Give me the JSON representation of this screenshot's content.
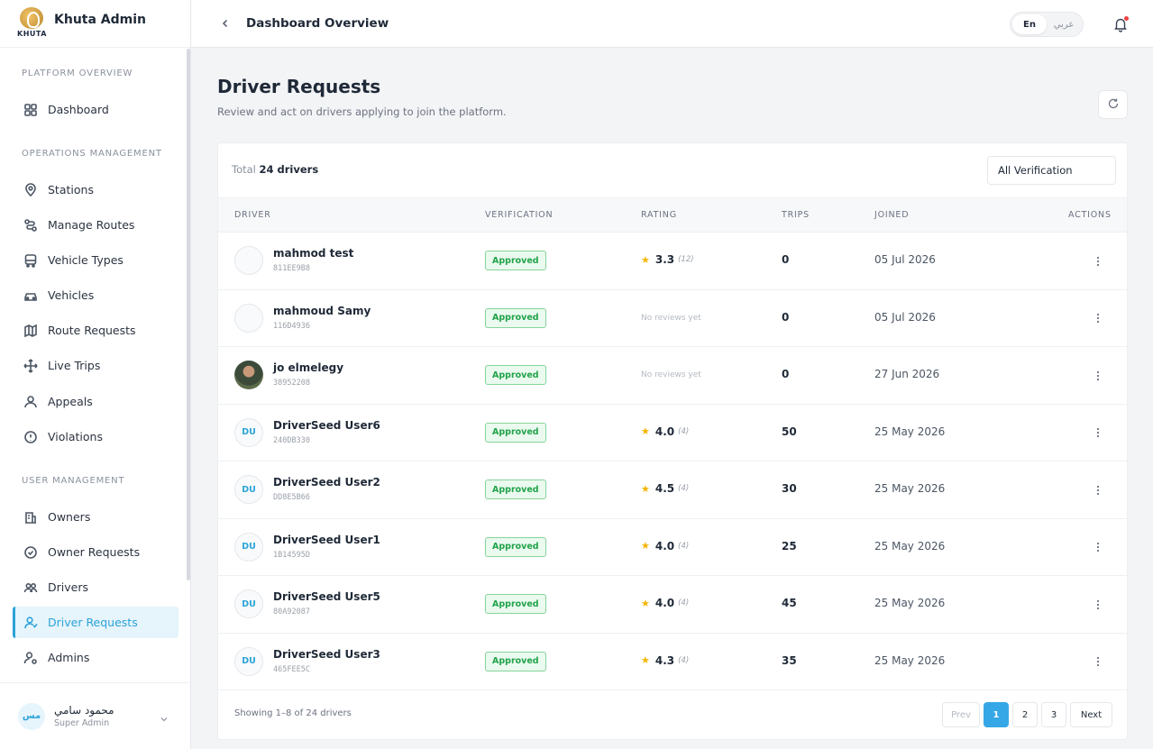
{
  "brand": {
    "title": "Khuta Admin",
    "logo_text": "KHUTA"
  },
  "header": {
    "title": "Dashboard Overview",
    "lang_en": "En",
    "lang_ar": "عربي"
  },
  "sidebar": {
    "sections": [
      {
        "label": "PLATFORM OVERVIEW"
      },
      {
        "label": "OPERATIONS MANAGEMENT"
      },
      {
        "label": "USER MANAGEMENT"
      }
    ],
    "items": [
      {
        "label": "Dashboard",
        "icon": "grid-icon"
      },
      {
        "label": "Stations",
        "icon": "map-pin-icon"
      },
      {
        "label": "Manage Routes",
        "icon": "route-icon"
      },
      {
        "label": "Vehicle Types",
        "icon": "bus-icon"
      },
      {
        "label": "Vehicles",
        "icon": "car-icon"
      },
      {
        "label": "Route Requests",
        "icon": "map-icon"
      },
      {
        "label": "Live Trips",
        "icon": "move-icon"
      },
      {
        "label": "Appeals",
        "icon": "hands-icon"
      },
      {
        "label": "Violations",
        "icon": "alert-circle-icon"
      },
      {
        "label": "Owners",
        "icon": "building-icon"
      },
      {
        "label": "Owner Requests",
        "icon": "check-circle-icon"
      },
      {
        "label": "Drivers",
        "icon": "users-icon"
      },
      {
        "label": "Driver Requests",
        "icon": "user-icon"
      },
      {
        "label": "Admins",
        "icon": "user-cog-icon"
      }
    ],
    "user": {
      "initials": "مس",
      "name": "محمود سامي",
      "role": "Super Admin"
    }
  },
  "page": {
    "title": "Driver Requests",
    "subtitle": "Review and act on drivers applying to join the platform."
  },
  "table": {
    "total_prefix": "Total",
    "total_value": "24 drivers",
    "filter_label": "All Verification",
    "columns": [
      "DRIVER",
      "VERIFICATION",
      "RATING",
      "TRIPS",
      "JOINED",
      "ACTIONS"
    ],
    "rows": [
      {
        "initials": "",
        "name": "mahmod test",
        "id": "811EE9B8",
        "verification": "Approved",
        "rating": "3.3",
        "reviews": "(12)",
        "trips": "0",
        "joined": "05 Jul 2026"
      },
      {
        "initials": "",
        "name": "mahmoud Samy",
        "id": "116D4936",
        "verification": "Approved",
        "no_reviews": "No reviews yet",
        "trips": "0",
        "joined": "05 Jul 2026"
      },
      {
        "initials": "",
        "photo": true,
        "name": "jo elmelegy",
        "id": "38952208",
        "verification": "Approved",
        "no_reviews": "No reviews yet",
        "trips": "0",
        "joined": "27 Jun 2026"
      },
      {
        "initials": "DU",
        "name": "DriverSeed User6",
        "id": "240DB330",
        "verification": "Approved",
        "rating": "4.0",
        "reviews": "(4)",
        "trips": "50",
        "joined": "25 May 2026"
      },
      {
        "initials": "DU",
        "name": "DriverSeed User2",
        "id": "DD8E5B66",
        "verification": "Approved",
        "rating": "4.5",
        "reviews": "(4)",
        "trips": "30",
        "joined": "25 May 2026"
      },
      {
        "initials": "DU",
        "name": "DriverSeed User1",
        "id": "1B14595D",
        "verification": "Approved",
        "rating": "4.0",
        "reviews": "(4)",
        "trips": "25",
        "joined": "25 May 2026"
      },
      {
        "initials": "DU",
        "name": "DriverSeed User5",
        "id": "80A92087",
        "verification": "Approved",
        "rating": "4.0",
        "reviews": "(4)",
        "trips": "45",
        "joined": "25 May 2026"
      },
      {
        "initials": "DU",
        "name": "DriverSeed User3",
        "id": "465FEE5C",
        "verification": "Approved",
        "rating": "4.3",
        "reviews": "(4)",
        "trips": "35",
        "joined": "25 May 2026"
      }
    ],
    "footer": {
      "showing": "Showing 1–8 of 24 drivers",
      "prev": "Prev",
      "pages": [
        "1",
        "2",
        "3"
      ],
      "next": "Next"
    }
  },
  "colors": {
    "accent": "#2ba3d8",
    "approved": "#22a34a",
    "star": "#f4b400",
    "notification": "#ef4444"
  }
}
